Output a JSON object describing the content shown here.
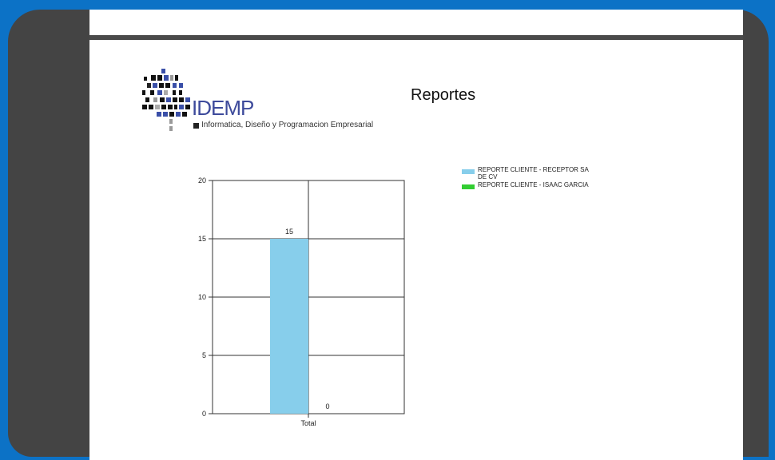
{
  "page": {
    "title": "Reportes"
  },
  "logo": {
    "brand": "IDEMP",
    "tagline": "Informatica, Diseño y Programacion Empresarial"
  },
  "colors": {
    "background": "#0c72c6",
    "frame": "#444444",
    "series1": "#87ceeb",
    "series2": "#32cd32"
  },
  "chart_data": {
    "type": "bar",
    "categories": [
      "Total"
    ],
    "series": [
      {
        "name": "REPORTE CLIENTE - RECEPTOR SA DE CV",
        "values": [
          15
        ],
        "color": "#87ceeb"
      },
      {
        "name": "REPORTE CLIENTE - ISAAC GARCIA",
        "values": [
          0
        ],
        "color": "#32cd32"
      }
    ],
    "ylim": [
      0,
      20
    ],
    "yticks": [
      0,
      5,
      10,
      15,
      20
    ],
    "grid": true,
    "legend": "top-right",
    "data_labels": [
      "15",
      "0"
    ]
  }
}
